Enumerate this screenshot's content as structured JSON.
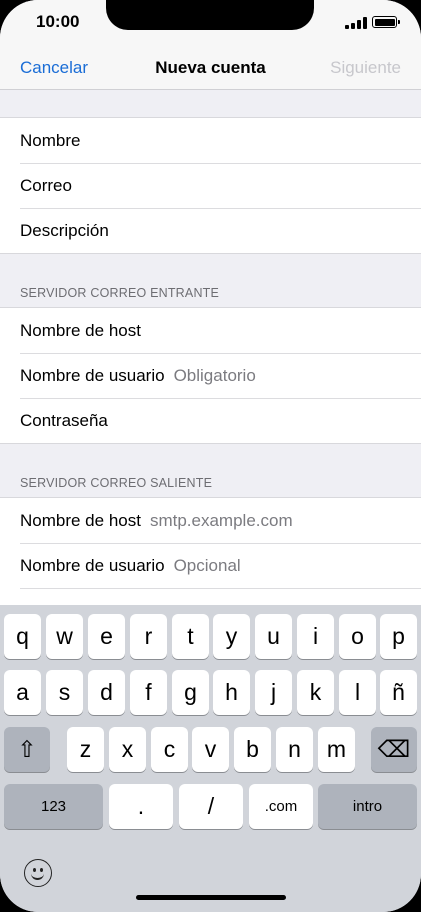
{
  "status_bar": {
    "time": "10:00"
  },
  "nav": {
    "cancel": "Cancelar",
    "title": "Nueva cuenta",
    "next": "Siguiente"
  },
  "account": [
    {
      "label": "Nombre",
      "value": ""
    },
    {
      "label": "Correo",
      "value": ""
    },
    {
      "label": "Descripción",
      "value": ""
    }
  ],
  "incoming": {
    "header": "SERVIDOR CORREO ENTRANTE",
    "rows": [
      {
        "label": "Nombre de host",
        "value": ""
      },
      {
        "label": "Nombre de usuario",
        "value": "Obligatorio"
      },
      {
        "label": "Contraseña",
        "value": ""
      }
    ]
  },
  "outgoing": {
    "header": "SERVIDOR CORREO SALIENTE",
    "rows": [
      {
        "label": "Nombre de host",
        "value": "smtp.example.com"
      },
      {
        "label": "Nombre de usuario",
        "value": "Opcional"
      }
    ]
  },
  "keyboard": {
    "row1": [
      "q",
      "w",
      "e",
      "r",
      "t",
      "y",
      "u",
      "i",
      "o",
      "p"
    ],
    "row2": [
      "a",
      "s",
      "d",
      "f",
      "g",
      "h",
      "j",
      "k",
      "l",
      "ñ"
    ],
    "row3": [
      "z",
      "x",
      "c",
      "v",
      "b",
      "n",
      "m"
    ],
    "shift": "⇧",
    "delete": "⌫",
    "numbers": "123",
    "dot": ".",
    "slash": "/",
    "dotcom": ".com",
    "return": "intro"
  }
}
